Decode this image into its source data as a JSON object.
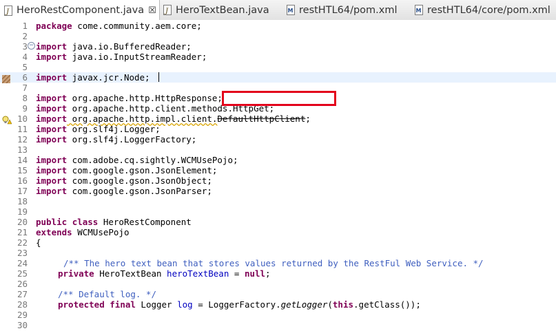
{
  "tabs": [
    {
      "label": "HeroRestComponent.java",
      "icon": "java-file-icon",
      "active": true,
      "close": "☒"
    },
    {
      "label": "HeroTextBean.java",
      "icon": "java-file-icon",
      "active": false
    },
    {
      "label": "restHTL64/pom.xml",
      "icon": "maven-pom-icon",
      "active": false
    },
    {
      "label": "restHTL64/core/pom.xml",
      "icon": "maven-pom-icon",
      "active": false
    }
  ],
  "editor": {
    "line_numbers": [
      "1",
      "2",
      "3",
      "4",
      "5",
      "6",
      "7",
      "8",
      "9",
      "10",
      "11",
      "12",
      "13",
      "14",
      "15",
      "16",
      "17",
      "18",
      "19",
      "20",
      "21",
      "22",
      "23",
      "24",
      "25",
      "26",
      "27",
      "28",
      "29",
      "30"
    ],
    "lines": {
      "l1": {
        "kw": "package",
        "rest": " come.community.aem.core;"
      },
      "l3": {
        "kw": "import",
        "rest": " java.io.BufferedReader;"
      },
      "l4": {
        "kw": "import",
        "rest": " java.io.InputStreamReader;"
      },
      "l6": {
        "kw": "import",
        "rest": " javax.jcr.Node;"
      },
      "l8": {
        "kw": "import",
        "rest": " org.apache.http.HttpResponse;"
      },
      "l9": {
        "kw": "import",
        "rest": " org.apache.http.client.methods.HttpGet;"
      },
      "l10": {
        "kw": "import",
        "rest": " org.apache.http.impl.client.",
        "deprecated": "DefaultHttpClient",
        "end": ";"
      },
      "l11": {
        "kw": "import",
        "rest": " org.slf4j.Logger;"
      },
      "l12": {
        "kw": "import",
        "rest": " org.slf4j.LoggerFactory;"
      },
      "l14": {
        "kw": "import",
        "rest": " com.adobe.cq.sightly.WCMUsePojo;"
      },
      "l15": {
        "kw": "import",
        "rest": " com.google.gson.JsonElement;"
      },
      "l16": {
        "kw": "import",
        "rest": " com.google.gson.JsonObject;"
      },
      "l17": {
        "kw": "import",
        "rest": " com.google.gson.JsonParser;"
      },
      "l20": {
        "kw1": "public",
        "kw2": "class",
        "rest": " HeroRestComponent"
      },
      "l21": {
        "kw": "extends",
        "rest": " WCMUsePojo"
      },
      "l22": {
        "rest": "{"
      },
      "l24": {
        "comment": "/** The hero text bean that stores values returned by the RestFul Web Service. */"
      },
      "l25": {
        "kw": "private",
        "type": " HeroTextBean ",
        "field": "heroTextBean",
        "mid": " = ",
        "kw_end": "null",
        "end": ";"
      },
      "l27": {
        "comment": "/** Default log. */"
      },
      "l28": {
        "kw1": "protected",
        "kw2": "final",
        "type": " Logger ",
        "field": "log",
        "mid": " = LoggerFactory.",
        "method": "getLogger",
        "open": "(",
        "kw3": "this",
        "end": ".getClass());"
      }
    }
  },
  "colors": {
    "keyword": "#7f0055",
    "comment": "#3f5fbf",
    "field": "#0000c0",
    "highlight_box": "#e3001b"
  }
}
